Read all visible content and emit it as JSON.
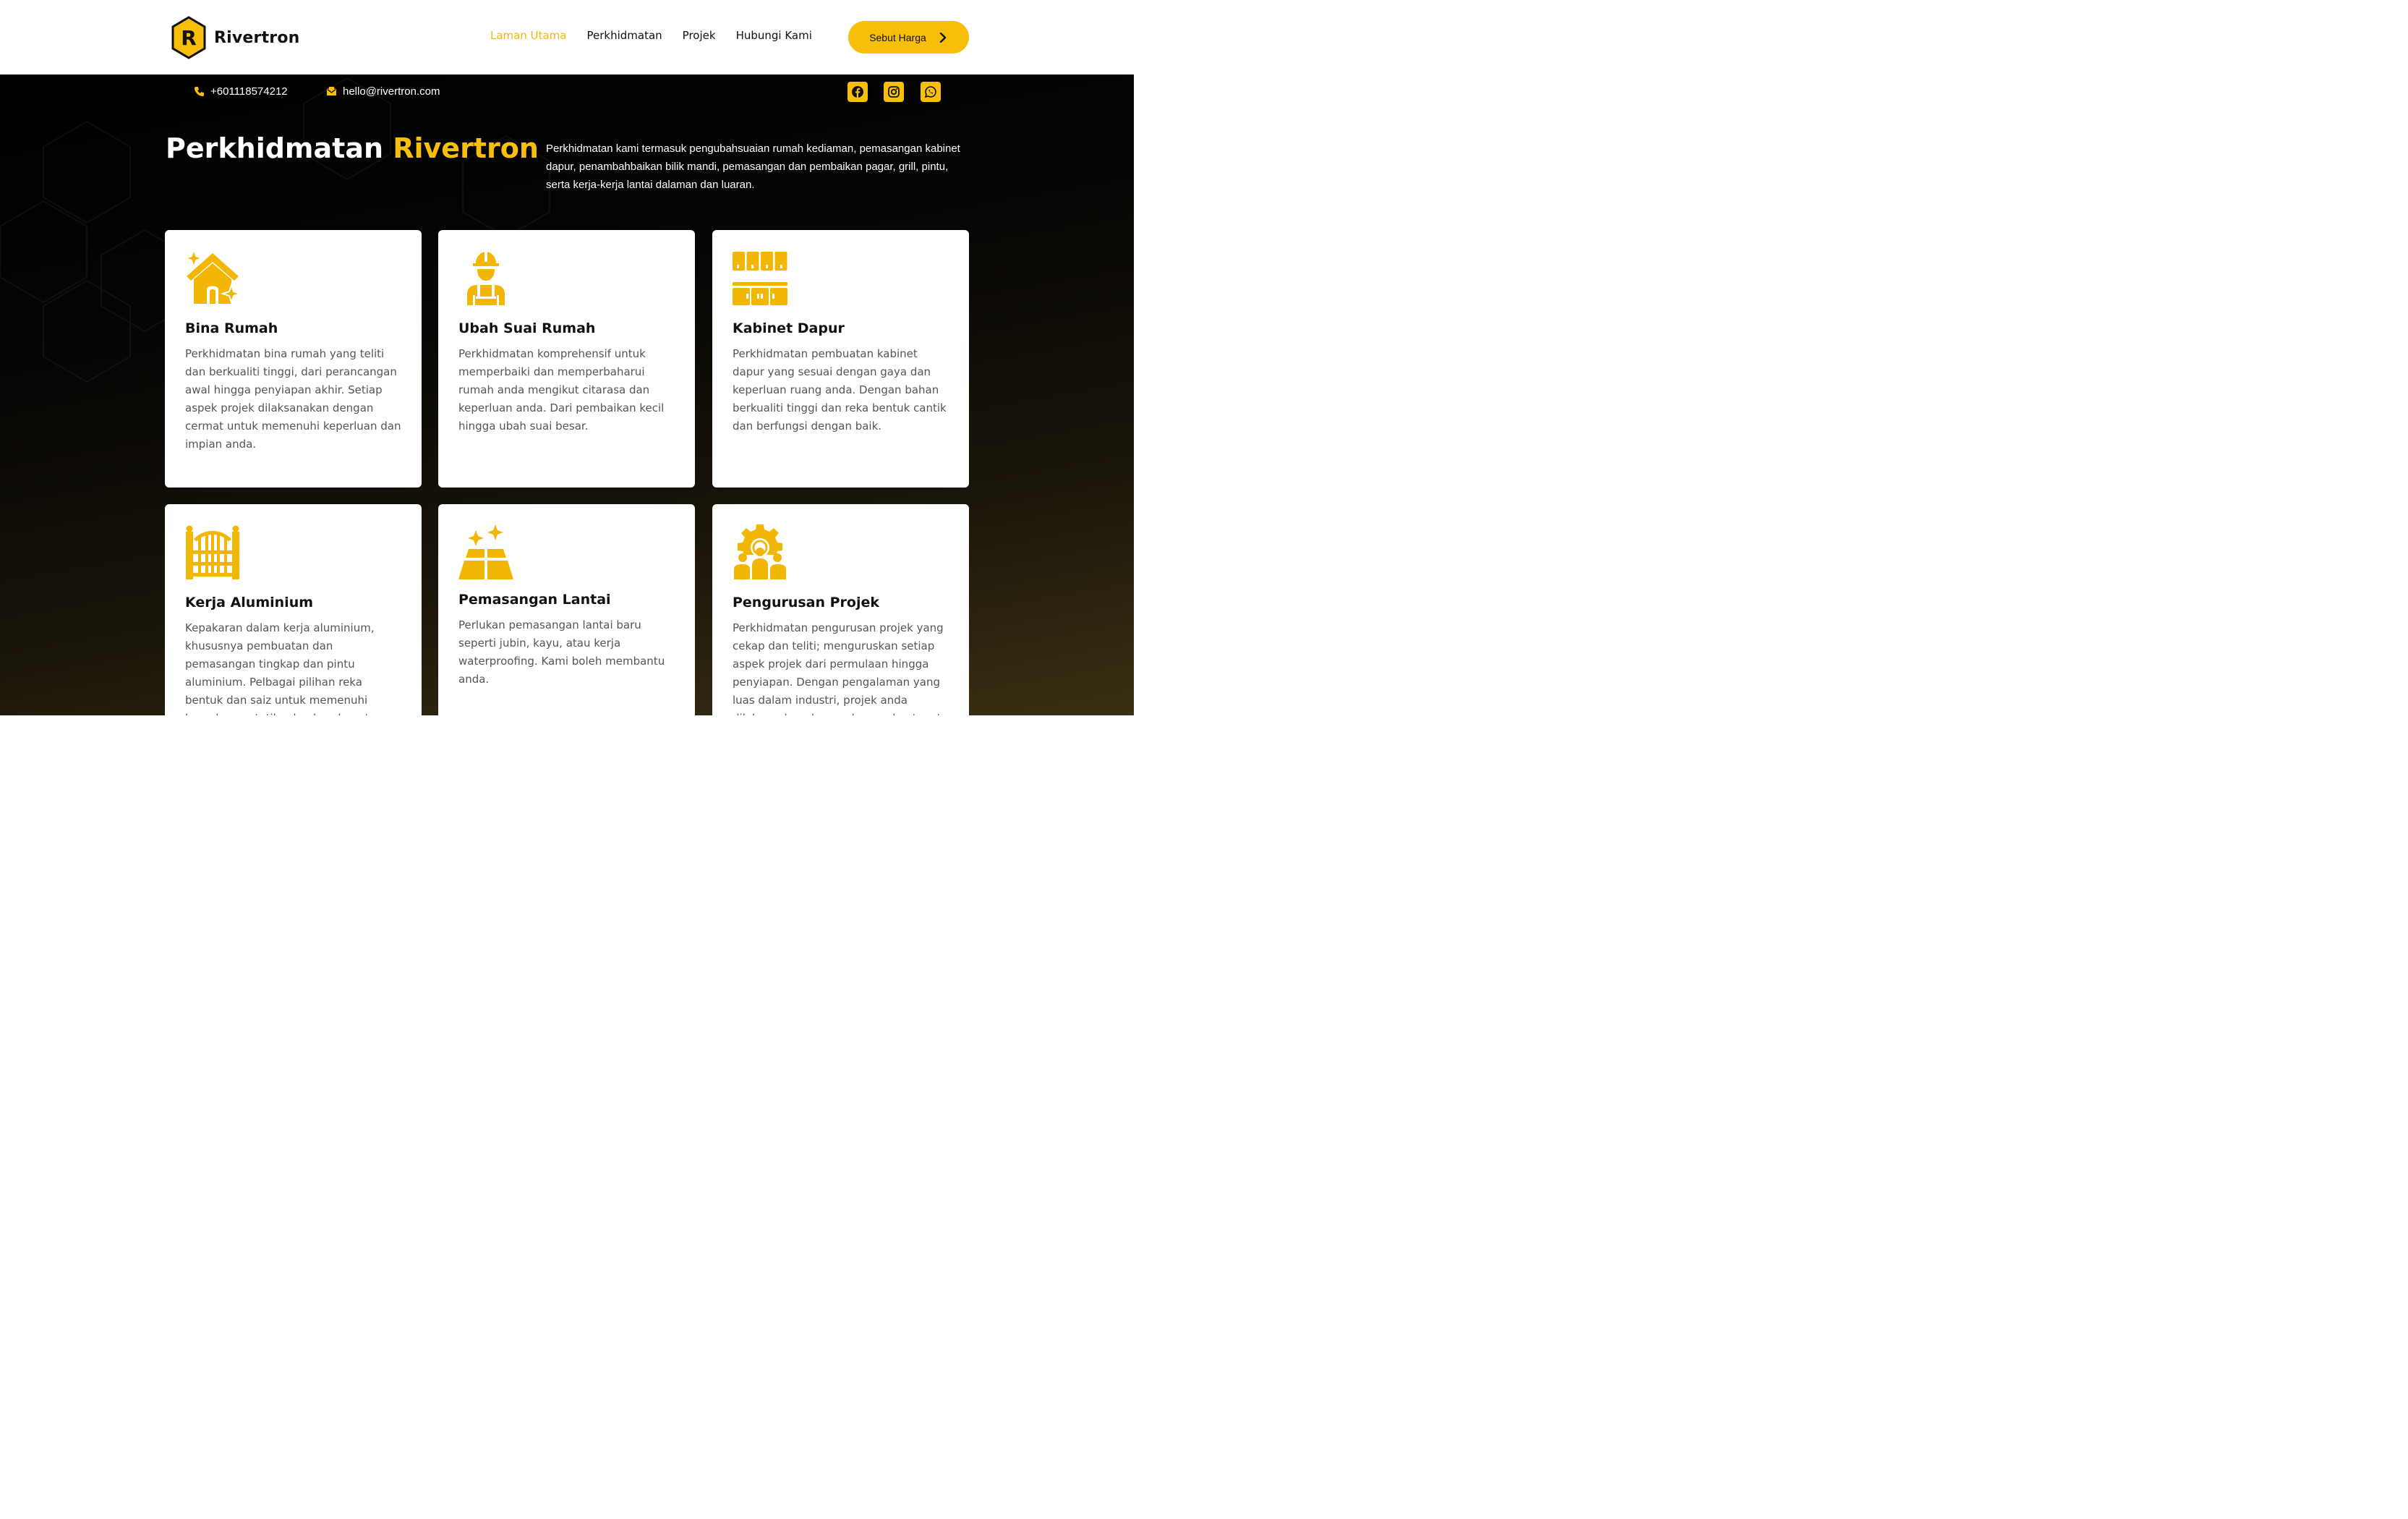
{
  "brand": {
    "letter": "R",
    "name": "Rivertron",
    "accent": "#F7BE0A"
  },
  "nav": [
    {
      "label": "Laman Utama",
      "active": true
    },
    {
      "label": "Perkhidmatan",
      "active": false
    },
    {
      "label": "Projek",
      "active": false
    },
    {
      "label": "Hubungi Kami",
      "active": false
    }
  ],
  "cta": {
    "label": "Sebut Harga",
    "icon": "chevron-right-icon"
  },
  "topbar": {
    "phone": "+601118574212",
    "email": "hello@rivertron.com",
    "social": [
      "facebook-icon",
      "instagram-icon",
      "whatsapp-icon"
    ]
  },
  "section": {
    "title_main": "Perkhidmatan",
    "title_accent": "Rivertron",
    "description": "Perkhidmatan kami termasuk pengubahsuaian rumah kediaman, pemasangan kabinet dapur, penambahbaikan bilik mandi, pemasangan dan pembaikan pagar, grill, pintu, serta kerja-kerja lantai dalaman dan luaran."
  },
  "services": [
    {
      "icon": "house-sparkle-icon",
      "title": "Bina Rumah",
      "text": "Perkhidmatan bina rumah yang teliti dan berkualiti tinggi, dari perancangan awal hingga penyiapan akhir. Setiap aspek projek dilaksanakan dengan cermat untuk memenuhi keperluan dan impian anda."
    },
    {
      "icon": "worker-icon",
      "title": "Ubah Suai Rumah",
      "text": "Perkhidmatan komprehensif untuk memperbaiki dan memperbaharui rumah anda mengikut citarasa dan keperluan anda. Dari pembaikan kecil hingga ubah suai besar."
    },
    {
      "icon": "kitchen-cabinet-icon",
      "title": "Kabinet Dapur",
      "text": "Perkhidmatan pembuatan kabinet dapur yang sesuai dengan gaya dan keperluan ruang anda. Dengan bahan berkualiti tinggi dan reka bentuk cantik dan berfungsi dengan baik."
    },
    {
      "icon": "gate-icon",
      "title": "Kerja Aluminium",
      "text": "Kepakaran dalam kerja aluminium, khususnya pembuatan dan pemasangan tingkap dan pintu aluminium. Pelbagai pilihan reka bentuk dan saiz untuk memenuhi keperluan estetika dan keselamatan"
    },
    {
      "icon": "floor-tiles-icon",
      "title": "Pemasangan Lantai",
      "text": "Perlukan pemasangan lantai baru seperti jubin, kayu, atau kerja waterproofing. Kami boleh membantu anda."
    },
    {
      "icon": "gear-team-icon",
      "title": "Pengurusan Projek",
      "text": "Perkhidmatan pengurusan projek yang cekap dan teliti; menguruskan setiap aspek projek dari permulaan hingga penyiapan. Dengan pengalaman yang luas dalam industri, projek anda dilaksanakan dengan lancar dan tepat"
    }
  ]
}
